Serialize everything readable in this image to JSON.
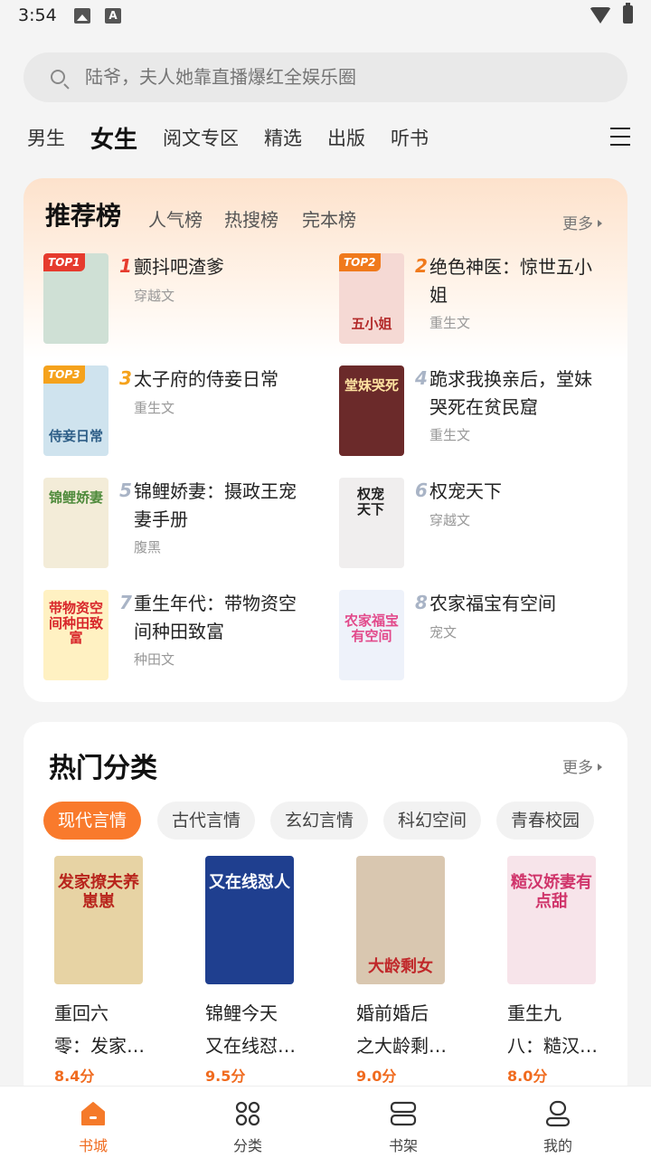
{
  "status": {
    "time": "3:54"
  },
  "search": {
    "placeholder": "陆爷，夫人她靠直播爆红全娱乐圈"
  },
  "tabs": [
    "男生",
    "女生",
    "阅文专区",
    "精选",
    "出版",
    "听书"
  ],
  "ranking": {
    "title": "推荐榜",
    "subtabs": [
      "人气榜",
      "热搜榜",
      "完本榜"
    ],
    "more": "更多",
    "items": [
      {
        "rank": "1",
        "badge": "TOP1",
        "name": "颤抖吧渣爹",
        "genre": "穿越文",
        "cover_text": "",
        "cover_bg": "#cfe0d5",
        "cover_fg": "#3a6a4a"
      },
      {
        "rank": "2",
        "badge": "TOP2",
        "name": "绝色神医：惊世五小姐",
        "genre": "重生文",
        "cover_text": "五小姐",
        "cover_bg": "#f5d9d4",
        "cover_fg": "#b32a2a"
      },
      {
        "rank": "3",
        "badge": "TOP3",
        "name": "太子府的侍妾日常",
        "genre": "重生文",
        "cover_text": "侍妾日常",
        "cover_bg": "#cfe3ee",
        "cover_fg": "#2c5d86"
      },
      {
        "rank": "4",
        "badge": "",
        "name": "跪求我换亲后，堂妹哭死在贫民窟",
        "genre": "重生文",
        "cover_text": "堂妹哭死",
        "cover_bg": "#6b2a2a",
        "cover_fg": "#ffe3a1"
      },
      {
        "rank": "5",
        "badge": "",
        "name": "锦鲤娇妻：摄政王宠妻手册",
        "genre": "腹黑",
        "cover_text": "锦鲤娇妻",
        "cover_bg": "#f3ecd8",
        "cover_fg": "#4e8a3b"
      },
      {
        "rank": "6",
        "badge": "",
        "name": "权宠天下",
        "genre": "穿越文",
        "cover_text": "权宠天下",
        "cover_bg": "#f0eeee",
        "cover_fg": "#222222"
      },
      {
        "rank": "7",
        "badge": "",
        "name": "重生年代：带物资空间种田致富",
        "genre": "种田文",
        "cover_text": "带物资空间种田致富",
        "cover_bg": "#fff1c2",
        "cover_fg": "#d8262a"
      },
      {
        "rank": "8",
        "badge": "",
        "name": "农家福宝有空间",
        "genre": "宠文",
        "cover_text": "农家福宝有空间",
        "cover_bg": "#eef2fa",
        "cover_fg": "#e24a8b"
      }
    ]
  },
  "hot": {
    "title": "热门分类",
    "more": "更多",
    "chips": [
      "现代言情",
      "古代言情",
      "玄幻言情",
      "科幻空间",
      "青春校园"
    ],
    "books": [
      {
        "name_line1": "重回六",
        "name_line2": "零：发家…",
        "score": "8.4分",
        "cover_text": "发家撩夫养崽崽",
        "cover_bg": "#e7d3a4",
        "cover_fg": "#b8241c"
      },
      {
        "name_line1": "锦鲤今天",
        "name_line2": "又在线怼…",
        "score": "9.5分",
        "cover_text": "又在线怼人",
        "cover_bg": "#1f3f8f",
        "cover_fg": "#ffffff"
      },
      {
        "name_line1": "婚前婚后",
        "name_line2": "之大龄剩…",
        "score": "9.0分",
        "cover_text": "大龄剩女",
        "cover_bg": "#d9c7b0",
        "cover_fg": "#c0282a"
      },
      {
        "name_line1": "重生九",
        "name_line2": "八：糙汉…",
        "score": "8.0分",
        "cover_text": "糙汉娇妻有点甜",
        "cover_bg": "#f7e4ea",
        "cover_fg": "#d0356b"
      }
    ]
  },
  "nav": [
    {
      "label": "书城",
      "icon": "bookstore-icon"
    },
    {
      "label": "分类",
      "icon": "category-icon"
    },
    {
      "label": "书架",
      "icon": "bookshelf-icon"
    },
    {
      "label": "我的",
      "icon": "profile-icon"
    }
  ],
  "colors": {
    "accent": "#f06b1f",
    "top1": "#e63b2e",
    "top2": "#f07a1c",
    "top3": "#f5a21c",
    "rank_other": "#a9b4c6"
  }
}
